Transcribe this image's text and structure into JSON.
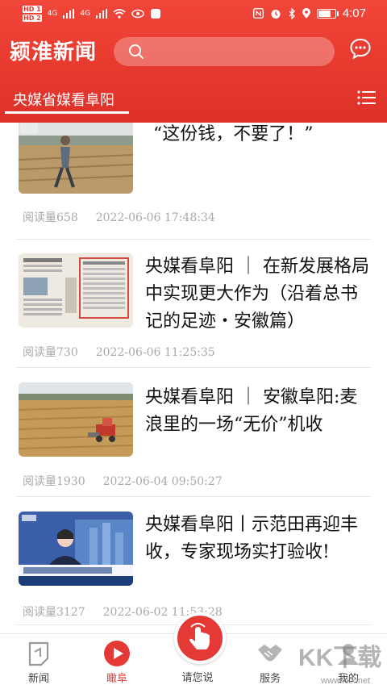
{
  "status_bar": {
    "sim1": "HD 1",
    "sim2": "HD 2",
    "signal1": "4G",
    "signal2": "4G",
    "time": "4:07"
  },
  "header": {
    "logo": "颍淮新闻",
    "search_placeholder": "",
    "active_channel": "央媒省媒看阜阳"
  },
  "articles": [
    {
      "title": "“这份钱，不要了！”",
      "reads": "阅读量658",
      "time": "2022-06-06 17:48:34",
      "thumb": "farmer-field-photo"
    },
    {
      "title": "央媒看阜阳 ｜ 在新发展格局中实现更大作为（沿着总书记的足迹・安徽篇）",
      "reads": "阅读量730",
      "time": "2022-06-06 11:25:35",
      "thumb": "newspaper-page-photo"
    },
    {
      "title": "央媒看阜阳 ｜ 安徽阜阳:麦浪里的一场“无价”机收",
      "reads": "阅读量1930",
      "time": "2022-06-04 09:50:27",
      "thumb": "wheat-harvester-photo"
    },
    {
      "title": "央媒看阜阳丨示范田再迎丰收，专家现场实打验收!",
      "reads": "阅读量3127",
      "time": "2022-06-02 11:53:28",
      "thumb": "tv-news-anchor-photo"
    }
  ],
  "tabs": [
    {
      "label": "新闻",
      "icon": "news-icon"
    },
    {
      "label": "瞰阜",
      "icon": "play-icon"
    },
    {
      "label": "请您说",
      "icon": "tap-hand-icon"
    },
    {
      "label": "服务",
      "icon": "handshake-icon"
    },
    {
      "label": "我的",
      "icon": "user-icon"
    }
  ],
  "watermark": {
    "text": "KK下载",
    "url": "www.kkx.net"
  },
  "colors": {
    "brand_red": "#e53935",
    "header_red": "#e6392e",
    "meta_gray": "#a8a8a8"
  }
}
